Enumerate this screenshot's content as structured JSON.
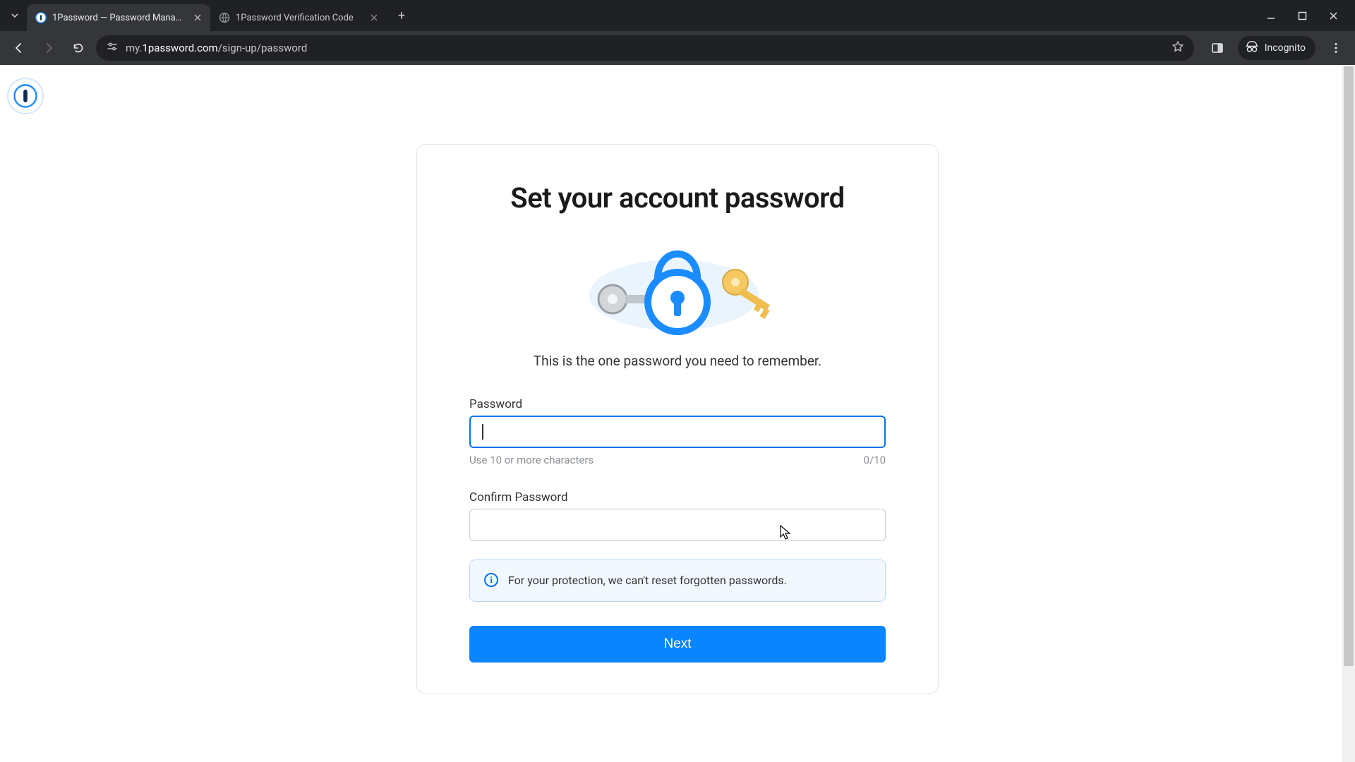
{
  "browser": {
    "tabs": [
      {
        "title": "1Password — Password Manager",
        "active": true
      },
      {
        "title": "1Password Verification Code",
        "active": false
      }
    ],
    "url_display_prefix": "my.",
    "url_display_domain": "1password.com",
    "url_display_path": "/sign-up/password",
    "incognito_label": "Incognito"
  },
  "page": {
    "heading": "Set your account password",
    "subtitle": "This is the one password you need to remember.",
    "password_label": "Password",
    "password_value": "",
    "password_hint": "Use 10 or more characters",
    "password_counter": "0/10",
    "confirm_label": "Confirm Password",
    "confirm_value": "",
    "info_text": "For your protection, we can't reset forgotten passwords.",
    "next_label": "Next"
  }
}
